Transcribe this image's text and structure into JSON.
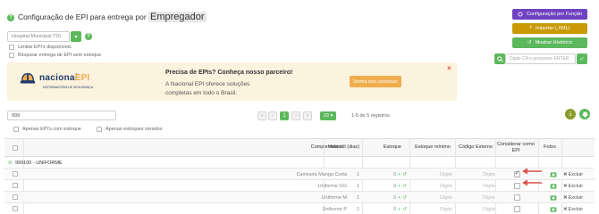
{
  "header": {
    "help_icon_glyph": "?",
    "title_prefix": "Configuração de EPI para entrega por",
    "title_highlight": "Empregador"
  },
  "filters": {
    "unit_value": "Hospital Municipal TDL",
    "unit_arrow": "▾",
    "limit_label": "Limitar EPI's disponíveis",
    "block_label": "Bloquear entrega de EPI sem estoque"
  },
  "actions": {
    "config_by_function": "Configuração por Função",
    "import_xml": "Importar (.XML)",
    "show_history": "Mostrar Histórico",
    "ca_search_placeholder": "Digite CA e pressione ENTER"
  },
  "banner": {
    "logo_text_1": "nacional",
    "logo_text_2": "EPI",
    "logo_sub": "DISTRIBUIDORA DE SEGURANÇA",
    "title": "Precisa de EPIs? Conheça nosso parceiro!",
    "text": "A Nacional EPI oferece soluções completas em todo o Brasil.",
    "button": "Venha nos conhecer",
    "close": "×"
  },
  "list_controls": {
    "search_value": "999",
    "first": "«",
    "prev": "‹",
    "page": "1",
    "next": "›",
    "last": "»",
    "per_page": "10",
    "per_page_arrow": "▾",
    "records": "1-5 de 5 registros",
    "only_in_stock": "Apenas EPI's com estoque",
    "only_zero_stock": "Apenas estoques zerados"
  },
  "table": {
    "columns": {
      "complemento": "Complemento",
      "vida_util": "Vida útil (dias)",
      "estoque": "Estoque",
      "estoque_minimo": "Estoque mínimo",
      "codigo_externo": "Código Externo",
      "considerar": "Considerar como EPI",
      "fotos": "Fotos"
    },
    "group": {
      "expand": "⊖",
      "label": "999100 - UNIFORME"
    },
    "rows": [
      {
        "complemento": "Camiseta Manga Curta",
        "vida": "1",
        "estoque": "0",
        "minimo": "Digite",
        "codigo": "Digite",
        "considerar": true
      },
      {
        "complemento": "Uniforme GG",
        "vida": "1",
        "estoque": "0",
        "minimo": "Digite",
        "codigo": "Digite",
        "considerar": false
      },
      {
        "complemento": "Uniforme M",
        "vida": "1",
        "estoque": "0",
        "minimo": "Digite",
        "codigo": "Digite",
        "considerar": false
      },
      {
        "complemento": "Uniforme P",
        "vida": "1",
        "estoque": "0",
        "minimo": "Digite",
        "codigo": "Digite",
        "considerar": false
      }
    ],
    "excluir": "Excluir",
    "plus": "+"
  },
  "colors": {
    "green": "#5cb85c",
    "purple": "#6f42c1",
    "orange": "#f0ad4e",
    "banner_bg": "#fcf3de",
    "red": "#d9534f"
  }
}
